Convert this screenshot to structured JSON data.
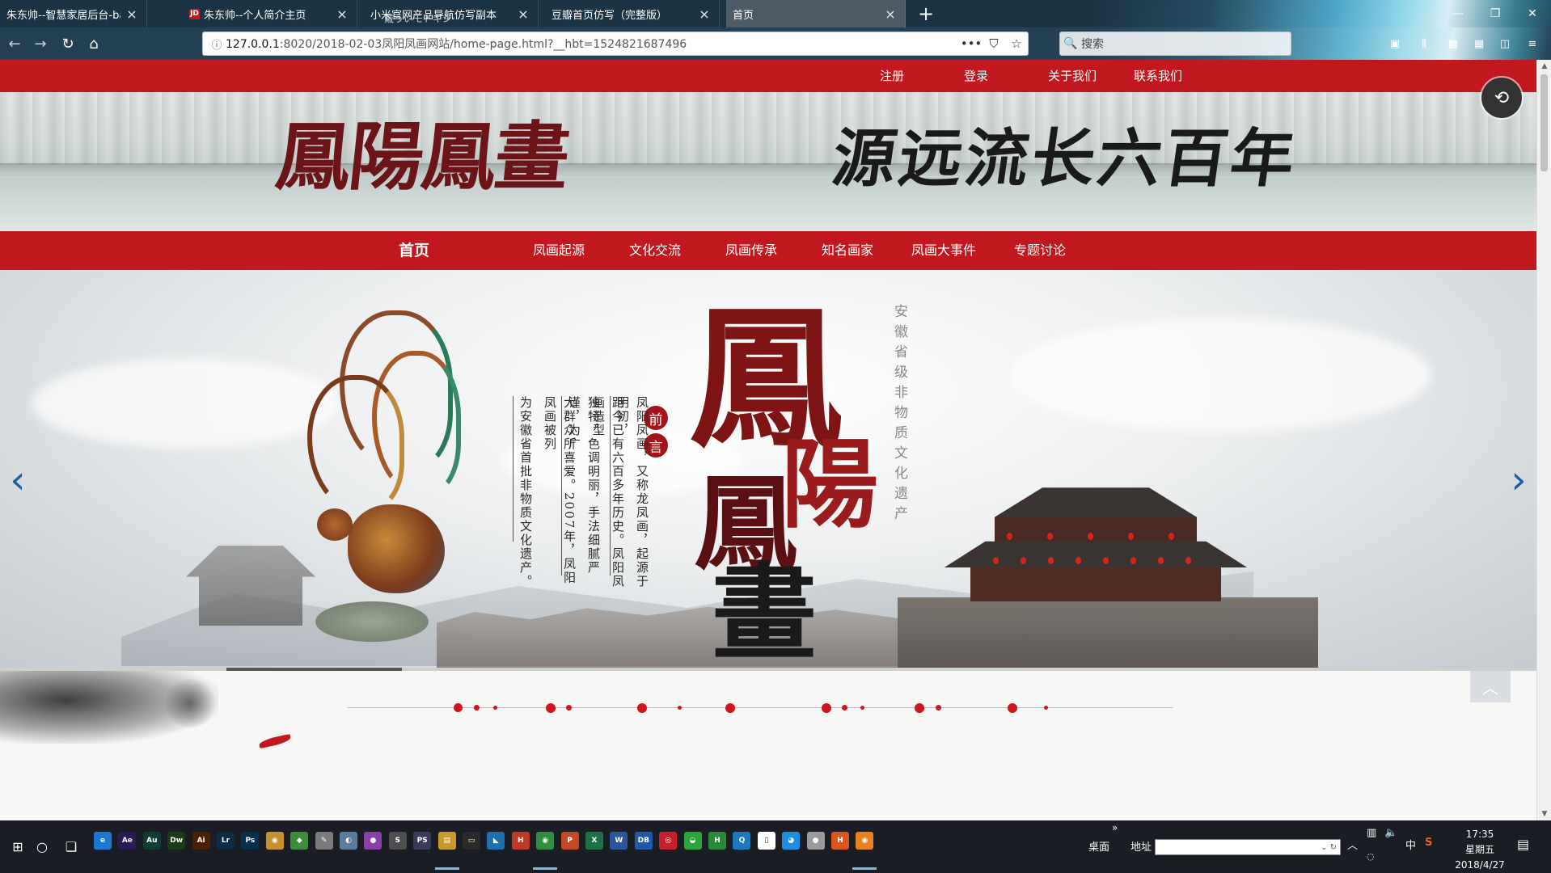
{
  "browser": {
    "tabs": [
      {
        "title": "朱东帅--智慧家居后台-bata版",
        "favicon": "",
        "active": false
      },
      {
        "title": "朱东帅--个人简介主页",
        "favicon": "JD",
        "active": false
      },
      {
        "title": "小米官网产品导航仿写副本",
        "favicon": "",
        "active": false
      },
      {
        "title": "豆瓣首页仿写（完整版）",
        "favicon": "",
        "active": false
      },
      {
        "title": "首页",
        "favicon": "",
        "active": true
      }
    ],
    "close_glyph": "×",
    "new_tab_glyph": "+",
    "tab_watermark": "戴ういモドギジ",
    "window_controls": {
      "minimize": "—",
      "maximize": "❐",
      "close": "✕"
    },
    "url": "127.0.0.1:8020/2018-02-03凤阳凤画网站/home-page.html?__hbt=1524821687496",
    "url_host": "127.0.0.1",
    "url_path": ":8020/2018-02-03凤阳凤画网站/home-page.html?__hbt=1524821687496",
    "url_actions": {
      "more": "•••",
      "pocket": "⛉",
      "bookmark": "☆"
    },
    "search_placeholder": "搜索",
    "nav_glyphs": {
      "back": "←",
      "forward": "→",
      "reload": "↻",
      "home": "⌂",
      "info": "ⓘ",
      "search": "🔍"
    }
  },
  "site": {
    "top_links": [
      "注册",
      "登录",
      "关于我们",
      "联系我们"
    ],
    "banner": {
      "logo_text": "鳳陽鳳畫",
      "slogan": "源远流长六百年"
    },
    "main_nav": [
      "首页",
      "凤画起源",
      "文化交流",
      "凤画传承",
      "知名画家",
      "凤画大事件",
      "专题讨论"
    ],
    "hero": {
      "preface_seal": [
        "前",
        "言"
      ],
      "preface_lines": [
        "凤阳凤画，又称龙凤画，起源于明初，",
        "距今已有六百多年历史。凤阳凤画造型",
        "独特，色调明丽，手法细腻严谨，为广",
        "大群众所喜爱。2007年，凤阳凤画被列",
        "为安徽省首批非物质文化遗产。"
      ],
      "calligraphy": [
        "鳳",
        "陽",
        "鳳",
        "畫"
      ],
      "side_caption": "安徽省级非物质文化遗产",
      "prev_arrow": "‹",
      "next_arrow": "›",
      "slider_progress": 0.114
    },
    "float_button_glyph": "⟲",
    "back_to_top_glyph": "︿"
  },
  "taskbar": {
    "start_glyph": "⊞",
    "search_glyph": "○",
    "taskview_glyph": "❏",
    "apps": [
      {
        "name": "edge",
        "label": "e",
        "color": "#1e78d2"
      },
      {
        "name": "after-effects",
        "label": "Ae",
        "color": "#2a1a55"
      },
      {
        "name": "audition",
        "label": "Au",
        "color": "#0f3d33"
      },
      {
        "name": "dreamweaver",
        "label": "Dw",
        "color": "#1d3a16"
      },
      {
        "name": "illustrator",
        "label": "Ai",
        "color": "#4a2000"
      },
      {
        "name": "lightroom",
        "label": "Lr",
        "color": "#0c2c45"
      },
      {
        "name": "photoshop",
        "label": "Ps",
        "color": "#06304d"
      },
      {
        "name": "chrome-canary",
        "label": "◉",
        "color": "#c8902a"
      },
      {
        "name": "app-green",
        "label": "◆",
        "color": "#3d8d3a"
      },
      {
        "name": "notepad",
        "label": "✎",
        "color": "#7a7a7a"
      },
      {
        "name": "paint",
        "label": "◐",
        "color": "#5a7c9a"
      },
      {
        "name": "maps",
        "label": "●",
        "color": "#8b3fa8"
      },
      {
        "name": "sublime",
        "label": "S",
        "color": "#4d4d4d"
      },
      {
        "name": "pscc",
        "label": "PS",
        "color": "#3a3a5a"
      },
      {
        "name": "explorer",
        "label": "▤",
        "color": "#c99a2a"
      },
      {
        "name": "cmd",
        "label": "▭",
        "color": "#2a2a2a"
      },
      {
        "name": "vscode",
        "label": "◣",
        "color": "#1f6fb0"
      },
      {
        "name": "hbuilder-red",
        "label": "H",
        "color": "#c03a2a"
      },
      {
        "name": "chrome",
        "label": "◉",
        "color": "#2f8f3f"
      },
      {
        "name": "powerpoint",
        "label": "P",
        "color": "#c44a23"
      },
      {
        "name": "excel",
        "label": "X",
        "color": "#1e7145"
      },
      {
        "name": "word",
        "label": "W",
        "color": "#2b579a"
      },
      {
        "name": "onedrive",
        "label": "DB",
        "color": "#1f5aa8"
      },
      {
        "name": "netease",
        "label": "◎",
        "color": "#c8202a"
      },
      {
        "name": "wechat",
        "label": "◒",
        "color": "#2aa53a"
      },
      {
        "name": "hbuilder",
        "label": "H",
        "color": "#2a8a3a"
      },
      {
        "name": "qq-browser",
        "label": "Q",
        "color": "#1a7bc0"
      },
      {
        "name": "file",
        "label": "▯",
        "color": "#ffffff"
      },
      {
        "name": "qq",
        "label": "◕",
        "color": "#1d8fe0"
      },
      {
        "name": "app-gray",
        "label": "●",
        "color": "#9a9a9a"
      },
      {
        "name": "hbuilder-orange",
        "label": "H",
        "color": "#d8561f"
      },
      {
        "name": "firefox",
        "label": "◉",
        "color": "#e8801c"
      }
    ],
    "more_glyph": "»",
    "desktop_label": "桌面",
    "address_label": "地址",
    "address_glyphs": "⌄ ↻",
    "tray_glyphs": {
      "chevron": "︿",
      "network": "▥",
      "volume": "🔈",
      "ime": "中",
      "sogou": "S",
      "wifi": "◌",
      "notify": "▤"
    },
    "clock_time": "17:35",
    "clock_weekday": "星期五",
    "clock_date": "2018/4/27"
  }
}
